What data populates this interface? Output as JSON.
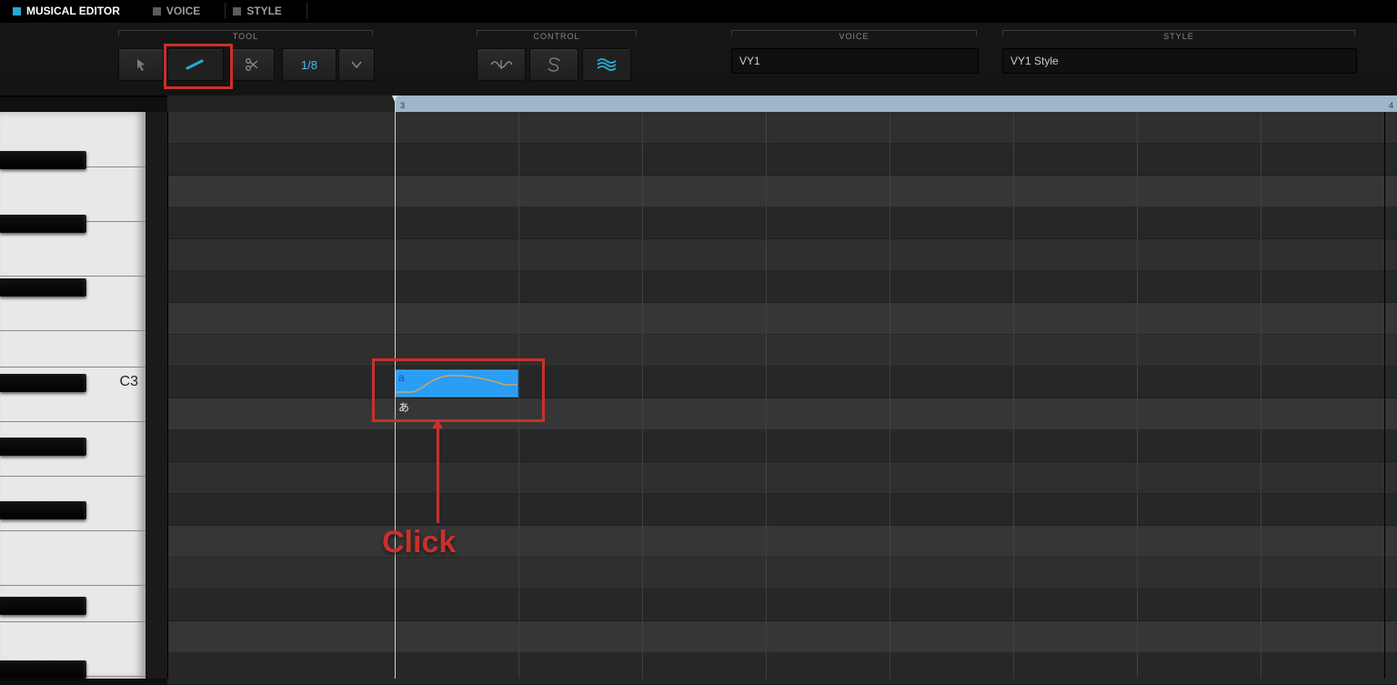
{
  "tabs": {
    "musical": "MUSICAL EDITOR",
    "voice": "VOICE",
    "style": "STYLE"
  },
  "groups": {
    "tool": "TOOL",
    "control": "CONTROL",
    "voice": "VOICE",
    "style": "STYLE"
  },
  "tool": {
    "quant": "1/8"
  },
  "voice": {
    "name": "VY1"
  },
  "style": {
    "name": "VY1 Style"
  },
  "ruler": {
    "bar3": "3",
    "bar4": "4"
  },
  "piano": {
    "c3": "C3"
  },
  "note": {
    "char": "a",
    "lyric": "あ"
  },
  "annotation": {
    "label": "Click"
  }
}
